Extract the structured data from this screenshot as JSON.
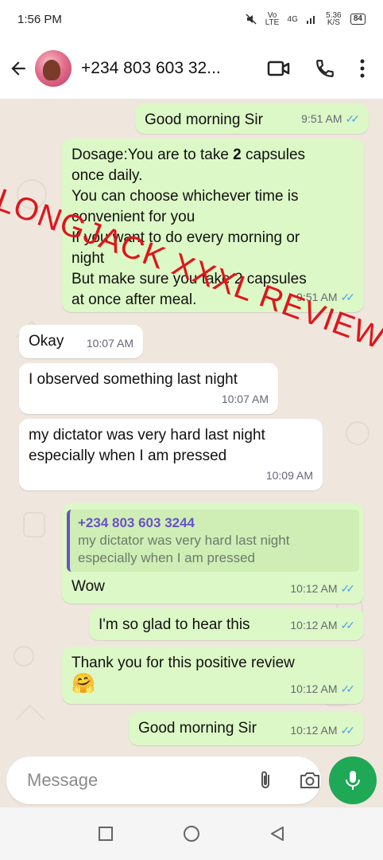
{
  "status_bar": {
    "time": "1:56 PM",
    "network_lte": "Vo LTE",
    "network_4g": "4G",
    "speed": "5.36 K/S",
    "battery": "84"
  },
  "header": {
    "contact_name": "+234 803 603 32...",
    "icons": [
      "back-arrow-icon",
      "video-call-icon",
      "phone-icon",
      "more-vert-icon"
    ]
  },
  "messages": [
    {
      "dir": "out",
      "text": "Good morning Sir",
      "time": "9:51 AM"
    },
    {
      "dir": "out",
      "text_lines": [
        "Dosage:You are to take ",
        "2",
        " capsules",
        "once daily.",
        "You can choose whichever time is",
        "convenient for you",
        "If you want to do every morning or",
        "night",
        "But make sure you take 2 capsules",
        "at once after meal."
      ],
      "time": "9:51 AM"
    },
    {
      "dir": "in",
      "text": "Okay",
      "time": "10:07 AM"
    },
    {
      "dir": "in",
      "text": "I observed something last night",
      "time": "10:07 AM"
    },
    {
      "dir": "in",
      "text_lines": [
        "my dictator was very hard last night",
        "especially when I am pressed"
      ],
      "time": "10:09 AM"
    },
    {
      "dir": "out",
      "quote": {
        "name": "+234 803 603 3244",
        "text_lines": [
          "my dictator was very hard last night",
          "especially when I am pressed"
        ]
      },
      "text": "Wow",
      "time": "10:12 AM"
    },
    {
      "dir": "out",
      "text": "I'm so glad to hear this",
      "time": "10:12 AM"
    },
    {
      "dir": "out",
      "text": "Thank you for this positive review",
      "emoji": "🤗",
      "time": "10:12 AM"
    },
    {
      "dir": "out",
      "text": "Good morning Sir",
      "time": "10:12 AM"
    }
  ],
  "watermark": {
    "line1": "LONGJACK XXXL REVIEW"
  },
  "composer": {
    "placeholder": "Message"
  },
  "colors": {
    "accent": "#1fa855",
    "outgoing_bubble": "#dcf8c6",
    "incoming_bubble": "#ffffff",
    "read_ticks": "#4fa3ea",
    "watermark": "#e0151b",
    "quote_bar": "#6a51c9"
  }
}
